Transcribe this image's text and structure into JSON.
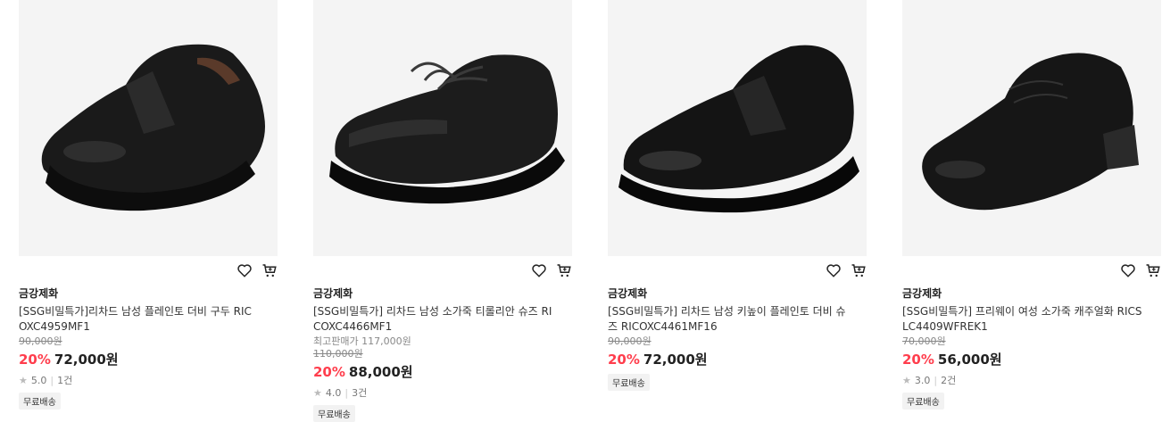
{
  "products": [
    {
      "brand": "금강제화",
      "name_line1": "[SSG비밀특가]리차드 남성 플레인토 더비 구두 RIC",
      "name_line2": "OXC4959MF1",
      "max_price": "",
      "original_price": "90,000원",
      "discount": "20%",
      "price": "72,000원",
      "rating": "5.0",
      "reviews": "1건",
      "badge": "무료배송",
      "icons": [
        "heart-icon",
        "cart-icon"
      ]
    },
    {
      "brand": "금강제화",
      "name_line1": "[SSG비밀특가] 리차드 남성 소가죽 티롤리안 슈즈 RI",
      "name_line2": "COXC4466MF1",
      "max_price": "최고판매가 117,000원",
      "original_price": "110,000원",
      "discount": "20%",
      "price": "88,000원",
      "rating": "4.0",
      "reviews": "3건",
      "badge": "무료배송",
      "icons": [
        "heart-icon",
        "cart-icon"
      ]
    },
    {
      "brand": "금강제화",
      "name_line1": "[SSG비밀특가] 리차드 남성 키높이 플레인토 더비 슈",
      "name_line2": "즈 RICOXC4461MF16",
      "max_price": "",
      "original_price": "90,000원",
      "discount": "20%",
      "price": "72,000원",
      "rating": "",
      "reviews": "",
      "badge": "무료배송",
      "icons": [
        "heart-icon",
        "cart-icon"
      ]
    },
    {
      "brand": "금강제화",
      "name_line1": "[SSG비밀특가] 프리웨이 여성 소가죽 캐주얼화 RICS",
      "name_line2": "LC4409WFREK1",
      "max_price": "",
      "original_price": "70,000원",
      "discount": "20%",
      "price": "56,000원",
      "rating": "3.0",
      "reviews": "2건",
      "badge": "무료배송",
      "icons": [
        "heart-icon",
        "cart-icon"
      ]
    }
  ],
  "colors": {
    "discount": "#ff3e4d",
    "image_bg": "#f4f4f4",
    "badge_bg": "#f2f2f2"
  }
}
